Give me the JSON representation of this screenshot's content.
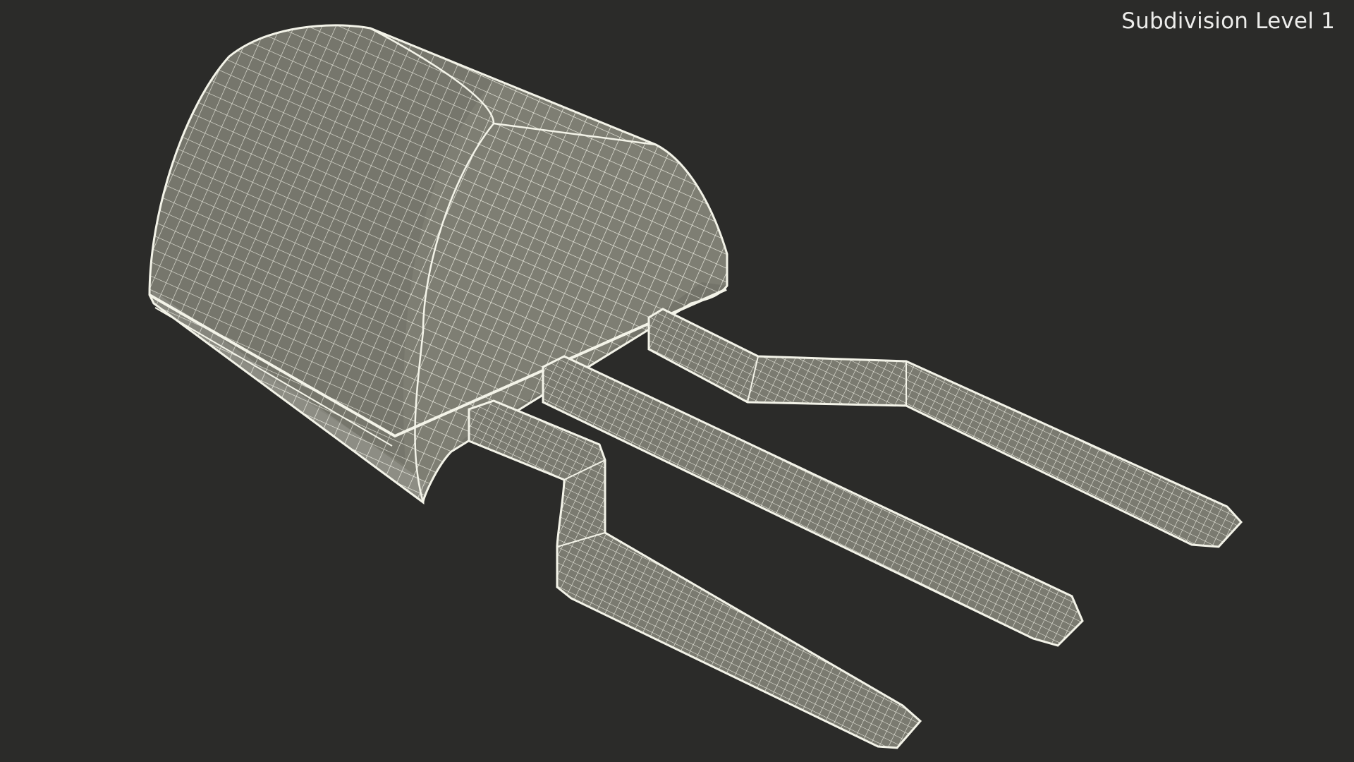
{
  "viewport": {
    "subdivision_label": "Subdivision Level 1",
    "background_color": "#2b2b29",
    "mesh_fill_color": "#808075",
    "wire_color": "#f3f3e8"
  },
  "model": {
    "name": "transistor-wireframe",
    "parts": [
      "body",
      "lead-left",
      "lead-middle",
      "lead-right"
    ]
  }
}
